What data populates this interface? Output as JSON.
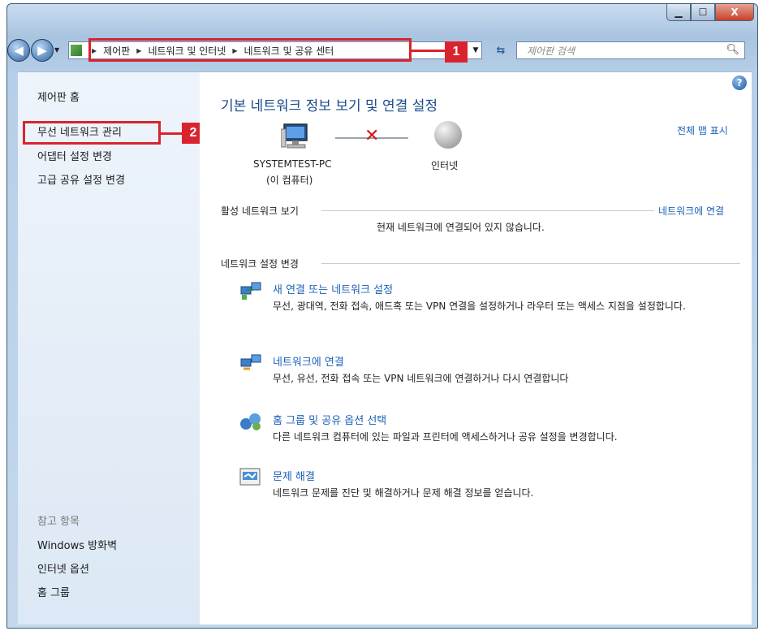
{
  "window": {
    "minimize": "▁",
    "maximize": "☐",
    "close": "X"
  },
  "address_bar": {
    "crumbs": [
      "제어판",
      "네트워크 및 인터넷",
      "네트워크 및 공유 센터"
    ],
    "search_placeholder": "제어판 검색"
  },
  "callouts": {
    "one": "1",
    "two": "2"
  },
  "sidebar": {
    "home": "제어판 홈",
    "items": [
      "무선 네트워크 관리",
      "어댑터 설정 변경",
      "고급 공유 설정 변경"
    ],
    "see_also_title": "참고 항목",
    "see_also": [
      "Windows 방화벽",
      "인터넷 옵션",
      "홈 그룹"
    ]
  },
  "main": {
    "title": "기본 네트워크 정보 보기 및 연결 설정",
    "full_map": "전체 맵 표시",
    "computer_name": "SYSTEMTEST-PC",
    "computer_sub": "(이 컴퓨터)",
    "internet_label": "인터넷",
    "active_networks_header": "활성 네트워크 보기",
    "connect_link": "네트워크에 연결",
    "no_connection": "현재 네트워크에 연결되어 있지 않습니다.",
    "change_settings_header": "네트워크 설정 변경",
    "tasks": [
      {
        "title": "새 연결 또는 네트워크 설정",
        "desc": "무선, 광대역, 전화 접속, 애드혹 또는 VPN 연결을 설정하거나 라우터 또는 액세스 지점을 설정합니다."
      },
      {
        "title": "네트워크에 연결",
        "desc": "무선, 유선, 전화 접속 또는 VPN 네트워크에 연결하거나 다시 연결합니다"
      },
      {
        "title": "홈 그룹 및 공유 옵션 선택",
        "desc": "다른 네트워크 컴퓨터에 있는 파일과 프린터에 액세스하거나 공유 설정을 변경합니다."
      },
      {
        "title": "문제 해결",
        "desc": "네트워크 문제를 진단 및 해결하거나 문제 해결 정보를 얻습니다."
      }
    ]
  }
}
